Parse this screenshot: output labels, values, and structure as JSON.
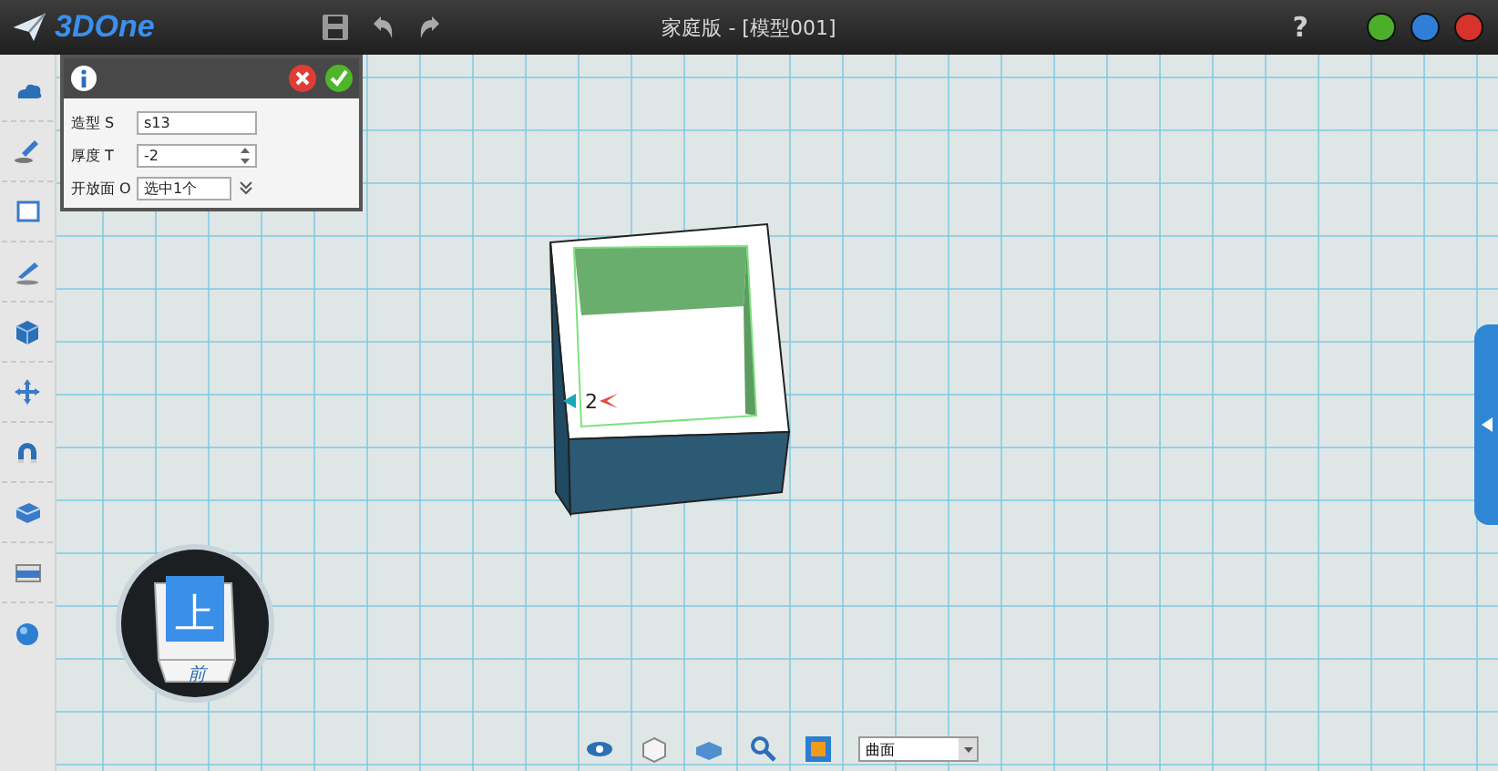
{
  "window": {
    "logo": "3DOne",
    "title": "家庭版 - [模型001]",
    "help": "?"
  },
  "dialog": {
    "fields": [
      {
        "label": "造型 S",
        "value": "s13",
        "kind": "text"
      },
      {
        "label": "厚度 T",
        "value": "-2",
        "kind": "spinner"
      },
      {
        "label": "开放面 O",
        "value": "选中1个",
        "kind": "picker"
      }
    ]
  },
  "model": {
    "dimension_label": "2"
  },
  "view_cube": {
    "top": "上",
    "front": "前"
  },
  "bottom_toolbar": {
    "filter": "曲面"
  }
}
